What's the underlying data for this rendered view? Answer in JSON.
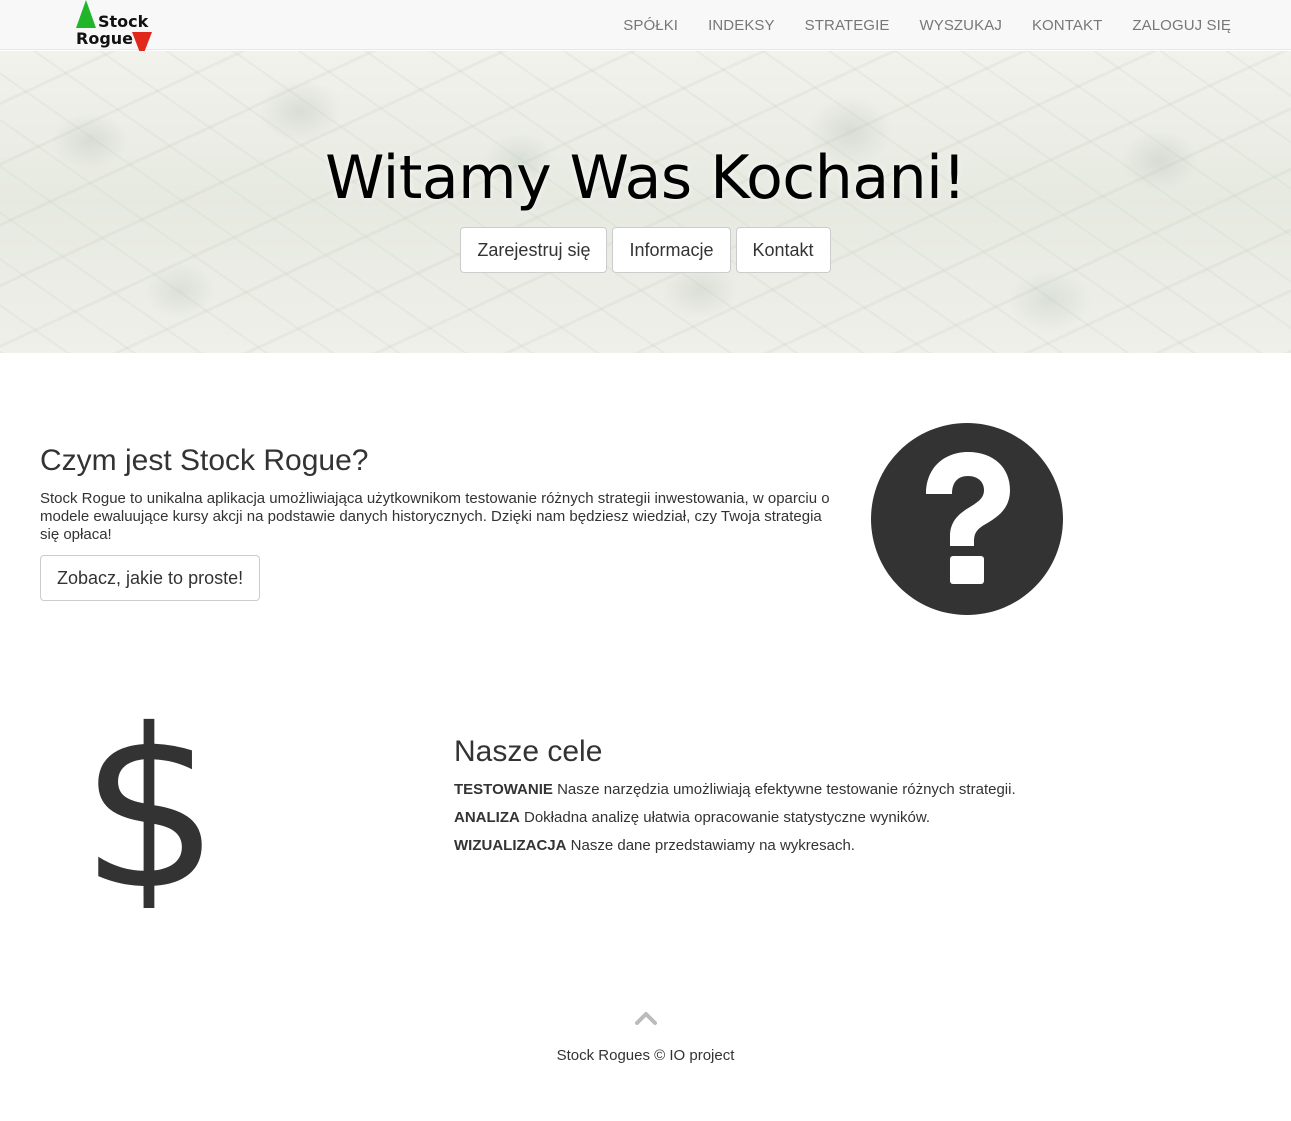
{
  "brand": {
    "line1": "Stock",
    "line2": "Rogue",
    "up_color": "#22b52a",
    "down_color": "#e0281c"
  },
  "nav": {
    "items": [
      {
        "label": "SPÓŁKI"
      },
      {
        "label": "INDEKSY"
      },
      {
        "label": "STRATEGIE"
      },
      {
        "label": "WYSZUKAJ"
      },
      {
        "label": "KONTAKT"
      },
      {
        "label": "ZALOGUJ SIĘ"
      }
    ]
  },
  "hero": {
    "title": "Witamy Was Kochani!",
    "buttons": [
      {
        "label": "Zarejestruj się"
      },
      {
        "label": "Informacje"
      },
      {
        "label": "Kontakt"
      }
    ]
  },
  "about": {
    "title": "Czym jest Stock Rogue?",
    "text": "Stock Rogue to unikalna aplikacja umożliwiająca użytkownikom testowanie różnych strategii inwestowania, w oparciu o modele ewaluujące kursy akcji na podstawie danych historycznych. Dzięki nam będziesz wiedział, czy Twoja strategia się opłaca!",
    "button": "Zobacz, jakie to proste!",
    "icon": "question-circle-icon"
  },
  "goals": {
    "title": "Nasze cele",
    "icon": "dollar-icon",
    "items": [
      {
        "term": "TESTOWANIE",
        "desc": "Nasze narzędzia umożliwiają efektywne testowanie różnych strategii."
      },
      {
        "term": "ANALIZA",
        "desc": "Dokładna analizę ułatwia opracowanie statystyczne wyników."
      },
      {
        "term": "WIZUALIZACJA",
        "desc": "Nasze dane przedstawiamy na wykresach."
      }
    ]
  },
  "footer": {
    "text": "Stock Rogues © IO project",
    "to_top_icon": "chevron-up-icon"
  },
  "colors": {
    "icon_dark": "#333333",
    "nav_text": "#777777",
    "navbar_bg": "#f8f8f8"
  }
}
